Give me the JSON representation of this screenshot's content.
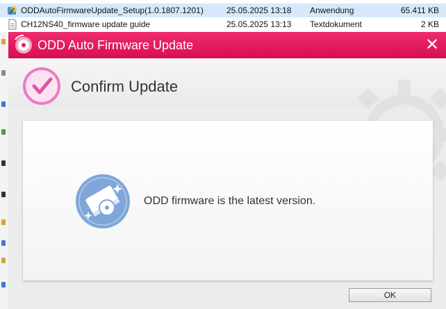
{
  "explorer": {
    "files": [
      {
        "name": "ODDAutoFirmwareUpdate_Setup(1.0.1807.1201)",
        "date": "25.05.2025 13:18",
        "type": "Anwendung",
        "size": "65.411 KB",
        "icon": "setup-app-icon"
      },
      {
        "name": "CH12NS40_firmware update guide",
        "date": "25.05.2025 13:13",
        "type": "Textdokument",
        "size": "2 KB",
        "icon": "text-document-icon"
      }
    ]
  },
  "dialog": {
    "title": "ODD Auto Firmware Update",
    "close_glyph": "✕",
    "header_title": "Confirm Update",
    "message": "ODD firmware is the latest version.",
    "ok_label": "OK"
  },
  "colors": {
    "titlebar": "#e31b5f",
    "accent_pink": "#ee7ac2",
    "icon_blue": "#7ea6d8"
  }
}
